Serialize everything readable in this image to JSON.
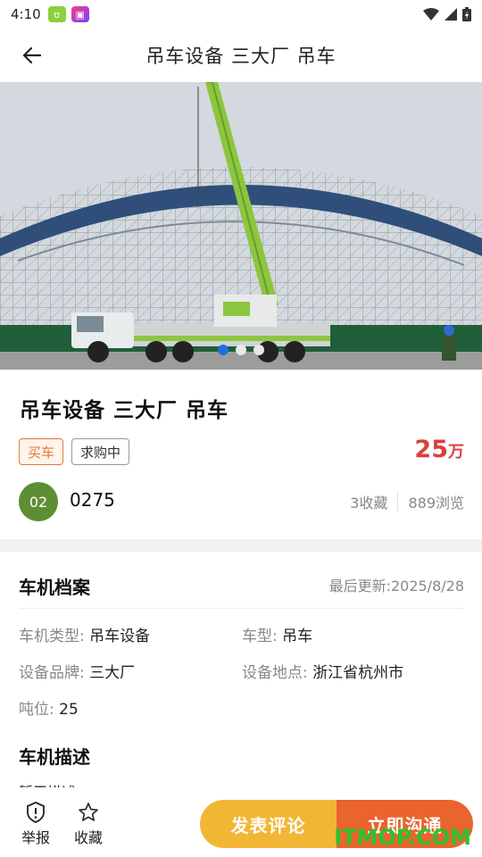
{
  "status_bar": {
    "time": "4:10"
  },
  "header": {
    "title": "吊车设备 三大厂 吊车"
  },
  "banner": {
    "slide_count": 3,
    "active_slide": 1
  },
  "listing": {
    "title": "吊车设备 三大厂 吊车",
    "tag_type": "买车",
    "tag_status": "求购中",
    "price_value": "25",
    "price_unit": "万",
    "user_avatar_text": "02",
    "user_name": "0275",
    "favorites": "3收藏",
    "views": "889浏览"
  },
  "profile": {
    "section_title": "车机档案",
    "updated": "最后更新:2025/8/28",
    "fields": [
      {
        "key": "车机类型: ",
        "value": "吊车设备"
      },
      {
        "key": "车型: ",
        "value": "吊车"
      },
      {
        "key": "设备品牌: ",
        "value": "三大厂"
      },
      {
        "key": "设备地点: ",
        "value": "浙江省杭州市"
      },
      {
        "key": "吨位: ",
        "value": "25"
      }
    ],
    "desc_title": "车机描述",
    "desc_text": "暂无描述"
  },
  "bottom_bar": {
    "report_label": "举报",
    "favorite_label": "收藏",
    "comment_button": "发表评论",
    "contact_button": "立即沟通"
  },
  "watermark": "ITMOP.COM",
  "colors": {
    "price": "#d9403d",
    "tag_buy": "#e4783a",
    "avatar": "#5e8e34",
    "comment_button": "#f1b634",
    "contact_button": "#e9642e",
    "dot_active": "#1f6fe0"
  }
}
